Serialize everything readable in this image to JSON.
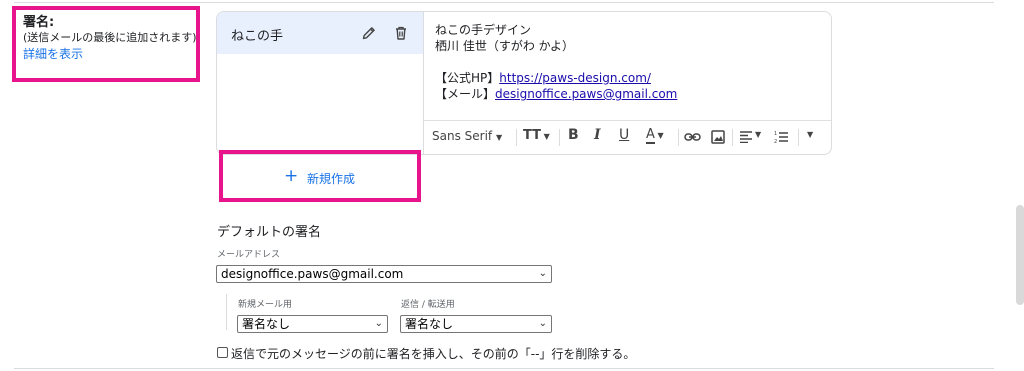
{
  "signature": {
    "label": "署名:",
    "note": "(送信メールの最後に追加されます)",
    "details_link": "詳細を表示"
  },
  "signature_list": {
    "items": [
      {
        "name": "ねこの手",
        "selected": true
      }
    ]
  },
  "editor": {
    "lines": [
      "ねこの手デザイン",
      "栖川 佳世（すがわ かよ）",
      "",
      "【公式HP】",
      "【メール】"
    ],
    "hp_link": "https://paws-design.com/",
    "mail_link": "designoffice.paws@gmail.com"
  },
  "toolbar": {
    "font": "Sans Serif",
    "items": [
      "font-select",
      "text-size",
      "bold",
      "italic",
      "underline",
      "text-color",
      "link",
      "image",
      "align",
      "numbered-list",
      "more"
    ]
  },
  "new_button": {
    "plus": "+",
    "label": "新規作成"
  },
  "defaults": {
    "title": "デフォルトの署名",
    "mail_label": "メールアドレス",
    "mail_value": "designoffice.paws@gmail.com",
    "new_mail_label": "新規メール用",
    "new_mail_value": "署名なし",
    "reply_label": "返信 / 転送用",
    "reply_value": "署名なし"
  },
  "checkbox": {
    "label": "返信で元のメッセージの前に署名を挿入し、その前の「--」行を削除する。",
    "checked": false
  },
  "colors": {
    "highlight_frame": "#e8148b",
    "accent": "#1a73e8",
    "selected_item_bg": "#e8f0fe"
  }
}
